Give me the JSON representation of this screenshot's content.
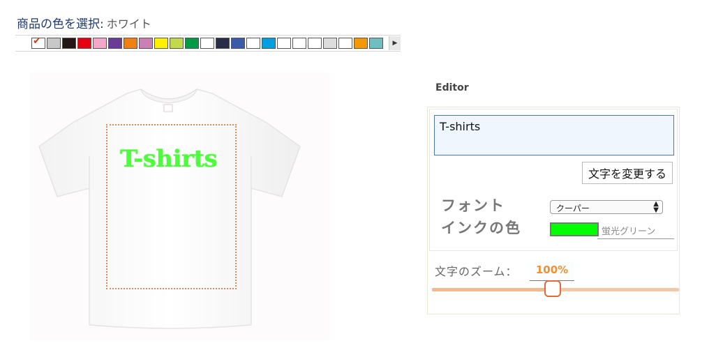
{
  "product_color": {
    "label": "商品の色を選択:",
    "selected_name": "ホワイト",
    "swatches": [
      {
        "name": "white",
        "color": "#ffffff",
        "selected": true
      },
      {
        "name": "silver-gray",
        "color": "#c8c8c8"
      },
      {
        "name": "black",
        "color": "#231815"
      },
      {
        "name": "red",
        "color": "#e60012"
      },
      {
        "name": "light-pink",
        "color": "#f4a7c6"
      },
      {
        "name": "purple",
        "color": "#6a3c96"
      },
      {
        "name": "orange",
        "color": "#f08011"
      },
      {
        "name": "pink",
        "color": "#cc7fb4"
      },
      {
        "name": "yellow",
        "color": "#fff100"
      },
      {
        "name": "lime-green",
        "color": "#c2d94d"
      },
      {
        "name": "green",
        "color": "#009944"
      },
      {
        "name": "white-2",
        "color": "#ffffff"
      },
      {
        "name": "navy",
        "color": "#2a2d4a"
      },
      {
        "name": "royal-blue",
        "color": "#3a5ba8"
      },
      {
        "name": "white-3",
        "color": "#ffffff"
      },
      {
        "name": "turquoise",
        "color": "#00a0e0"
      },
      {
        "name": "white-4",
        "color": "#ffffff"
      },
      {
        "name": "white-5",
        "color": "#ffffff"
      },
      {
        "name": "white-6",
        "color": "#ffffff"
      },
      {
        "name": "light-gray",
        "color": "#dcdcdc"
      },
      {
        "name": "white-7",
        "color": "#ffffff"
      },
      {
        "name": "sunflower",
        "color": "#f39800"
      },
      {
        "name": "jade",
        "color": "#6fbfc0"
      }
    ]
  },
  "preview": {
    "shirt_text": "T-shirts",
    "text_color": "#4dff3a"
  },
  "editor": {
    "title": "Editor",
    "text_value": "T-shirts",
    "change_button": "文字を変更する",
    "font_label": "フォント",
    "font_selected": "クーパー",
    "ink_label": "インクの色",
    "ink_color": "#00ff00",
    "ink_name_placeholder": "蛍光グリーン",
    "zoom_label": "文字のズーム：",
    "zoom_value": "100%",
    "zoom_fraction": 0.49
  }
}
